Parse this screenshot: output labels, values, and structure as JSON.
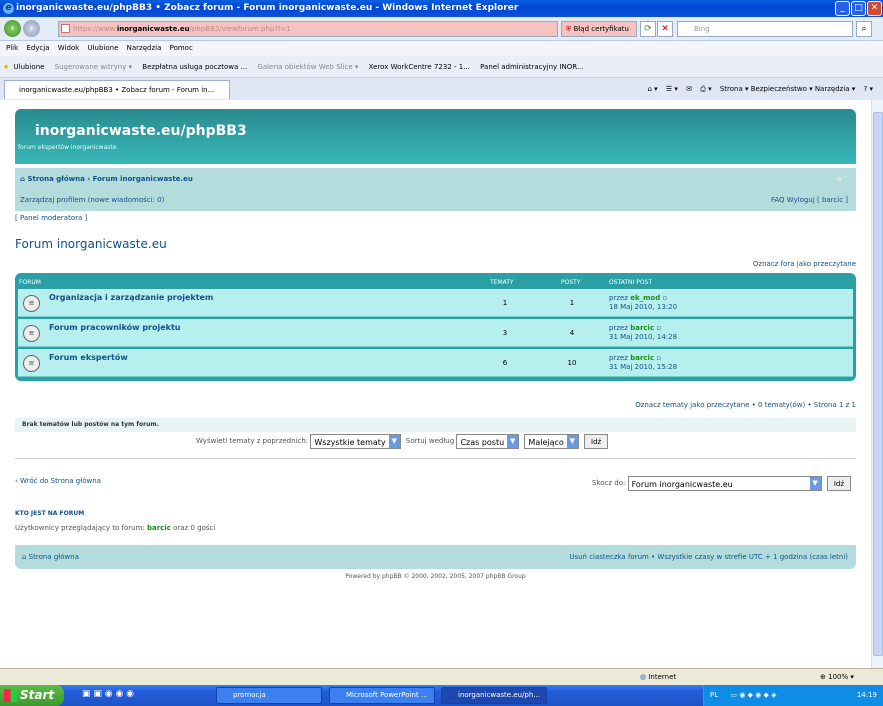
{
  "window": {
    "title": "inorganicwaste.eu/phpBB3 • Zobacz forum - Forum inorganicwaste.eu - Windows Internet Explorer",
    "min": "_",
    "max": "□",
    "close": "✕"
  },
  "address": {
    "url_prefix": "https://www.",
    "url_host": "inorganicwaste.eu",
    "url_path": "/phpBB3/viewforum.php?f=1",
    "cert": "Błąd certyfikatu",
    "search_placeholder": "Bing"
  },
  "menu": [
    "Plik",
    "Edycja",
    "Widok",
    "Ulubione",
    "Narzędzia",
    "Pomoc"
  ],
  "favorites": [
    "Ulubione",
    "Sugerowane witryny ▾",
    "Bezpłatna usługa pocztowa ...",
    "Galeria obiektów Web Slice ▾",
    "Xerox WorkCentre 7232 - 1...",
    "Panel administracyjny INOR..."
  ],
  "tab": {
    "label": "inorganicwaste.eu/phpBB3 • Zobacz forum - Forum in..."
  },
  "commands": "Strona ▾   Bezpieczeństwo ▾   Narzędzia ▾",
  "forum": {
    "site_title": "inorganicwaste.eu/phpBB3",
    "site_desc": "forum ekspertów inorganicwaste",
    "breadcrumb": "⌂ Strona główna ‹ Forum inorganicwaste.eu",
    "font_size": "-A^",
    "profile": "Zarządzaj profilem (nowe wiadomości: 0)",
    "faq_logout": "FAQ   Wyloguj [ barcic ]",
    "mod_panel": "[ Panel moderatora ]",
    "page_title": "Forum inorganicwaste.eu",
    "mark_forums": "Oznacz fora jako przeczytane",
    "headers": {
      "forum": "FORUM",
      "topics": "TEMATY",
      "posts": "POSTY",
      "last": "OSTATNI POST"
    },
    "rows": [
      {
        "name": "Organizacja i zarządzanie projektem",
        "topics": "1",
        "posts": "1",
        "by": "przez",
        "user": "ek_mod",
        "date": "18 Maj 2010, 13:20"
      },
      {
        "name": "Forum pracowników projektu",
        "topics": "3",
        "posts": "4",
        "by": "przez",
        "user": "barcic",
        "date": "31 Maj 2010, 14:28"
      },
      {
        "name": "Forum ekspertów",
        "topics": "6",
        "posts": "10",
        "by": "przez",
        "user": "barcic",
        "date": "31 Maj 2010, 15:28"
      }
    ],
    "mark_topics": "Oznacz tematy jako przeczytane • 0 tematy(ów) • Strona 1 z 1",
    "no_topics": "Brak tematów lub postów na tym forum.",
    "display_label": "Wyświetl tematy z poprzednich:",
    "display_value": "Wszystkie tematy",
    "sort_label": "Sortuj według",
    "sort_value": "Czas postu",
    "order_value": "Malejąco",
    "go": "Idź",
    "back": "‹ Wróć do Strona główna",
    "jump_label": "Skocz do:",
    "jump_value": "Forum inorganicwaste.eu",
    "who_head": "KTO JEST NA FORUM",
    "who_prefix": "Użytkownicy przeglądający to forum:",
    "who_user": "barcic",
    "who_suffix": "oraz 0 gości",
    "footer_home": "⌂ Strona główna",
    "footer_right": "Usuń ciasteczka forum • Wszystkie czasy w strefie UTC + 1 godzina (czas letni)",
    "powered": "Powered by phpBB © 2000, 2002, 2005, 2007 phpBB Group"
  },
  "statusbar": {
    "zone": "Internet",
    "zoom": "100%"
  },
  "taskbar": {
    "start": "Start",
    "items": [
      "promocja",
      "Microsoft PowerPoint ...",
      "inorganicwaste.eu/ph..."
    ],
    "lang": "PL",
    "clock": "14:19"
  }
}
